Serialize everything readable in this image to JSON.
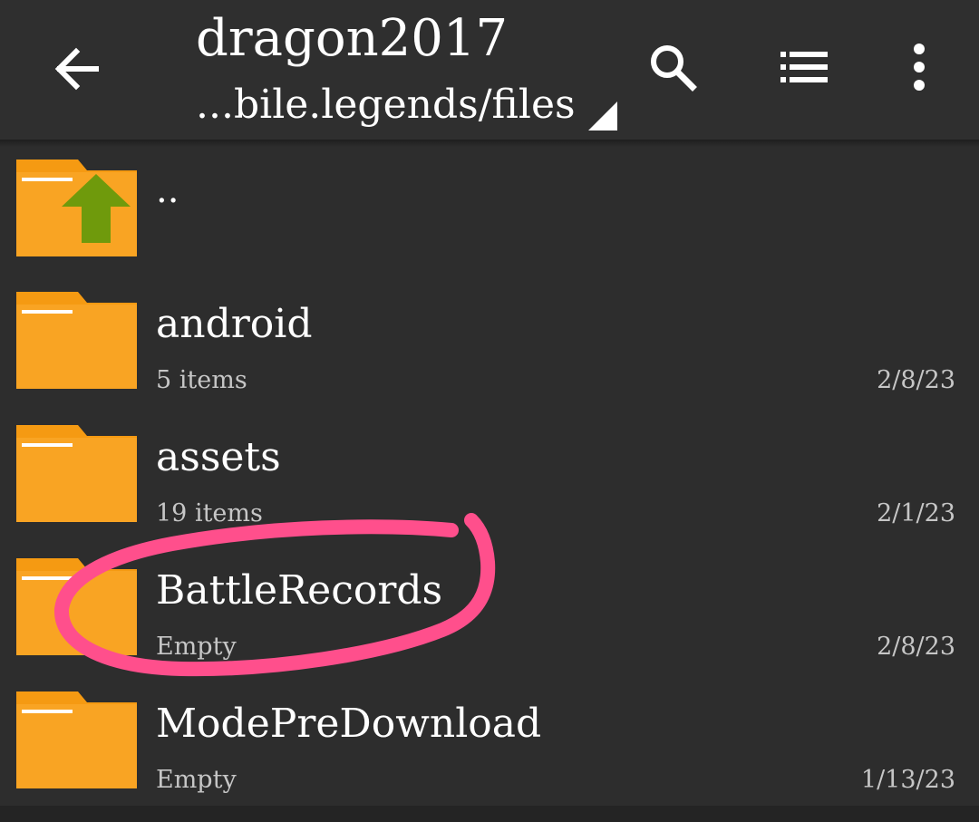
{
  "header": {
    "title": "dragon2017",
    "path": "...bile.legends/files",
    "back_icon": "arrow-left-icon",
    "search_icon": "search-icon",
    "view_icon": "list-view-icon",
    "menu_icon": "more-vertical-icon"
  },
  "files": [
    {
      "name": "..",
      "meta": "",
      "date": "",
      "icon": "folder-up-icon"
    },
    {
      "name": "android",
      "meta": "5 items",
      "date": "2/8/23",
      "icon": "folder-icon"
    },
    {
      "name": "assets",
      "meta": "19 items",
      "date": "2/1/23",
      "icon": "folder-icon"
    },
    {
      "name": "BattleRecords",
      "meta": "Empty",
      "date": "2/8/23",
      "icon": "folder-icon"
    },
    {
      "name": "ModePreDownload",
      "meta": "Empty",
      "date": "1/13/23",
      "icon": "folder-icon"
    }
  ],
  "colors": {
    "background": "#2d2d2d",
    "folder": "#f9a423",
    "folder_tab": "#f59a12",
    "up_arrow": "#6f9a0c",
    "annotation": "#ff4f8c",
    "text_primary": "#ffffff",
    "text_secondary": "#c6c6c6"
  }
}
